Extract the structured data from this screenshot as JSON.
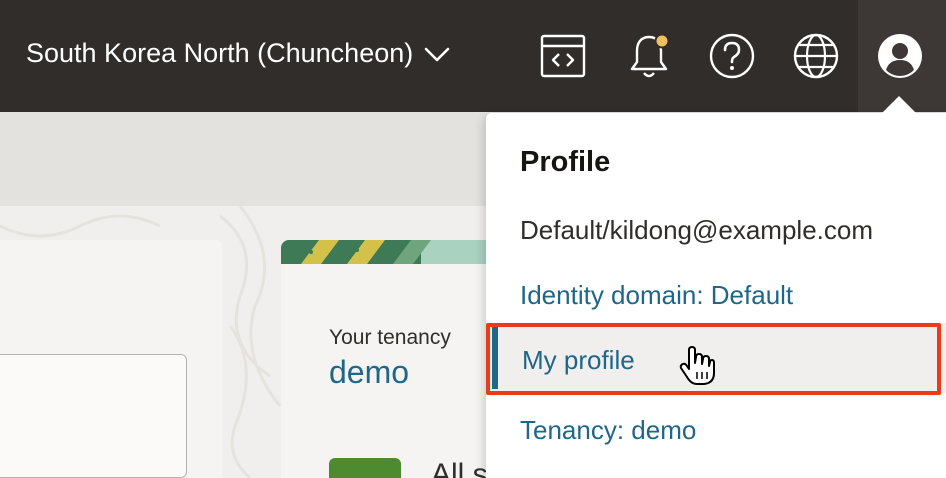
{
  "header": {
    "region": "South Korea North (Chuncheon)",
    "icons": [
      "code-editor-icon",
      "notifications-bell-icon",
      "help-icon",
      "language-globe-icon",
      "user-profile-icon"
    ]
  },
  "tenancy_card": {
    "label": "Your tenancy",
    "name": "demo",
    "partial_text": "All s"
  },
  "profile_menu": {
    "title": "Profile",
    "user": "Default/kildong@example.com",
    "identity_domain": "Identity domain: Default",
    "my_profile": "My profile",
    "tenancy": "Tenancy: demo"
  },
  "colors": {
    "header_bg": "#312d2a",
    "link": "#1f6687",
    "highlight": "#ee3a1b",
    "notification_dot": "#f0c060"
  }
}
